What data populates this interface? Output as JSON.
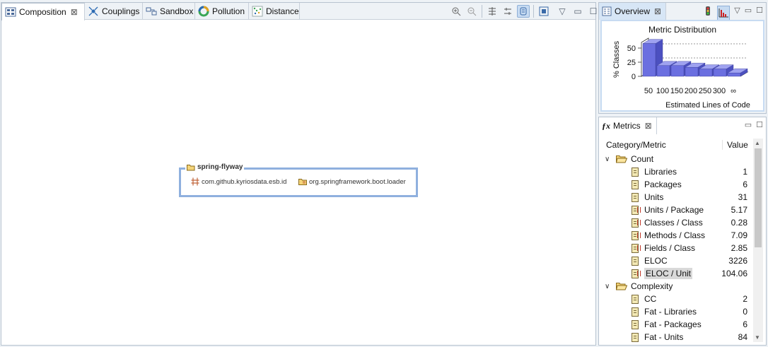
{
  "editor": {
    "tabs": [
      {
        "label": "Composition",
        "active": true,
        "close": "⊠"
      },
      {
        "label": "Couplings"
      },
      {
        "label": "Sandbox"
      },
      {
        "label": "Pollution"
      },
      {
        "label": "Distance"
      }
    ],
    "group": {
      "title": "spring-flyway",
      "packages": [
        "com.github.kyriosdata.esb.id",
        "org.springframework.boot.loader"
      ]
    }
  },
  "overview": {
    "tab_label": "Overview",
    "close": "⊠",
    "chart": {
      "title": "Metric Distribution",
      "ylabel": "% Classes",
      "xlabel": "Estimated Lines of Code",
      "yticks": [
        "50",
        "25",
        "0"
      ],
      "xticks": [
        "50",
        "100",
        "150",
        "200",
        "250",
        "300",
        "∞"
      ]
    }
  },
  "chart_data": {
    "type": "bar",
    "title": "Metric Distribution",
    "xlabel": "Estimated Lines of Code",
    "ylabel": "% Classes",
    "categories": [
      "50",
      "100",
      "150",
      "200",
      "250",
      "300",
      "∞"
    ],
    "values": [
      58,
      19,
      19,
      16,
      13,
      13,
      6
    ],
    "ylim": [
      0,
      60
    ]
  },
  "metrics": {
    "tab_label": "Metrics",
    "close": "⊠",
    "headers": {
      "metric": "Category/Metric",
      "value": "Value"
    },
    "rows": [
      {
        "type": "category",
        "label": "Count"
      },
      {
        "type": "metric",
        "label": "Libraries",
        "value": "1"
      },
      {
        "type": "metric",
        "label": "Packages",
        "value": "6"
      },
      {
        "type": "metric",
        "label": "Units",
        "value": "31"
      },
      {
        "type": "ratio",
        "label": "Units / Package",
        "value": "5.17"
      },
      {
        "type": "ratio",
        "label": "Classes / Class",
        "value": "0.28"
      },
      {
        "type": "ratio",
        "label": "Methods / Class",
        "value": "7.09"
      },
      {
        "type": "ratio",
        "label": "Fields / Class",
        "value": "2.85"
      },
      {
        "type": "metric",
        "label": "ELOC",
        "value": "3226"
      },
      {
        "type": "ratio",
        "label": "ELOC / Unit",
        "value": "104.06",
        "selected": true
      },
      {
        "type": "category",
        "label": "Complexity"
      },
      {
        "type": "metric",
        "label": "CC",
        "value": "2"
      },
      {
        "type": "metric",
        "label": "Fat - Libraries",
        "value": "0"
      },
      {
        "type": "metric",
        "label": "Fat - Packages",
        "value": "6"
      },
      {
        "type": "metric",
        "label": "Fat - Units",
        "value": "84"
      }
    ]
  },
  "colors": {
    "accent": "#8fb0de",
    "bar": "#6b6fe0",
    "bar_top": "#9fa2f0"
  }
}
